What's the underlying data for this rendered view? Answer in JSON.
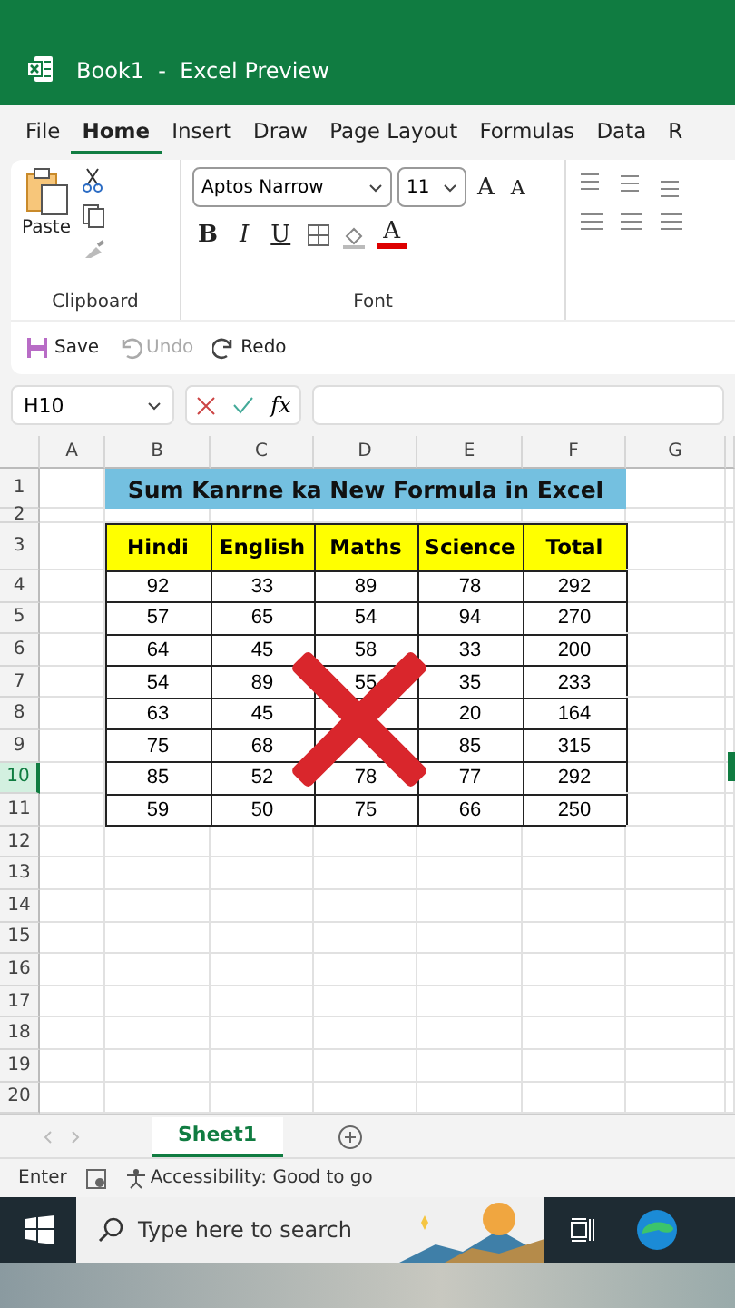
{
  "title_bar": {
    "title": "Book1  -  Excel Preview"
  },
  "menu_tabs": [
    {
      "label": "File",
      "selected": false
    },
    {
      "label": "Home",
      "selected": true
    },
    {
      "label": "Insert",
      "selected": false
    },
    {
      "label": "Draw",
      "selected": false
    },
    {
      "label": "Page Layout",
      "selected": false
    },
    {
      "label": "Formulas",
      "selected": false
    },
    {
      "label": "Data",
      "selected": false
    },
    {
      "label": "R",
      "selected": false
    }
  ],
  "ribbon": {
    "clipboard": {
      "paste": "Paste",
      "label": "Clipboard"
    },
    "font": {
      "name": "Aptos Narrow",
      "size": "11",
      "grow": "A",
      "shrink": "A",
      "styles": [
        "B",
        "I",
        "U"
      ],
      "font_color": "A",
      "label": "Font"
    }
  },
  "quick_access": [
    {
      "label": "Save",
      "disabled": false,
      "kind": "save"
    },
    {
      "label": "Undo",
      "disabled": true,
      "kind": "undo"
    },
    {
      "label": "Redo",
      "disabled": false,
      "kind": "redo"
    }
  ],
  "formula_bar": {
    "name_box": "H10",
    "fx": "fx"
  },
  "sheet": {
    "columns": [
      "A",
      "B",
      "C",
      "D",
      "E",
      "F",
      "G"
    ],
    "rows": [
      {
        "label": "1",
        "selected": false
      },
      {
        "label": "2",
        "selected": false
      },
      {
        "label": "3",
        "selected": false
      },
      {
        "label": "4",
        "selected": false
      },
      {
        "label": "5",
        "selected": false
      },
      {
        "label": "6",
        "selected": false
      },
      {
        "label": "7",
        "selected": false
      },
      {
        "label": "8",
        "selected": false
      },
      {
        "label": "9",
        "selected": false
      },
      {
        "label": "10",
        "selected": true
      },
      {
        "label": "11",
        "selected": false
      },
      {
        "label": "12",
        "selected": false
      },
      {
        "label": "13",
        "selected": false
      },
      {
        "label": "14",
        "selected": false
      },
      {
        "label": "15",
        "selected": false
      },
      {
        "label": "16",
        "selected": false
      },
      {
        "label": "17",
        "selected": false
      },
      {
        "label": "18",
        "selected": false
      },
      {
        "label": "19",
        "selected": false
      },
      {
        "label": "20",
        "selected": false
      }
    ],
    "title": "Sum Kanrne ka New Formula in Excel",
    "headers": [
      "Hindi",
      "English",
      "Maths",
      "Science",
      "Total"
    ],
    "data": [
      {
        "hindi": "92",
        "english": "33",
        "maths": "89",
        "science": "78",
        "total": "292"
      },
      {
        "hindi": "57",
        "english": "65",
        "maths": "54",
        "science": "94",
        "total": "270"
      },
      {
        "hindi": "64",
        "english": "45",
        "maths": "58",
        "science": "33",
        "total": "200"
      },
      {
        "hindi": "54",
        "english": "89",
        "maths": "55",
        "science": "35",
        "total": "233"
      },
      {
        "hindi": "63",
        "english": "45",
        "science": "20",
        "total": "164"
      },
      {
        "hindi": "75",
        "english": "68",
        "science": "85",
        "total": "315"
      },
      {
        "hindi": "85",
        "english": "52",
        "maths": "78",
        "science": "77",
        "total": "292"
      },
      {
        "hindi": "59",
        "english": "50",
        "maths": "75",
        "science": "66",
        "total": "250"
      }
    ],
    "overlay": {
      "kind": "cross"
    }
  },
  "sheet_tabs": [
    {
      "label": "Sheet1",
      "selected": true
    }
  ],
  "status_bar": {
    "mode": "Enter",
    "accessibility": "Accessibility: Good to go"
  },
  "taskbar": {
    "search_placeholder": "Type here to search"
  }
}
